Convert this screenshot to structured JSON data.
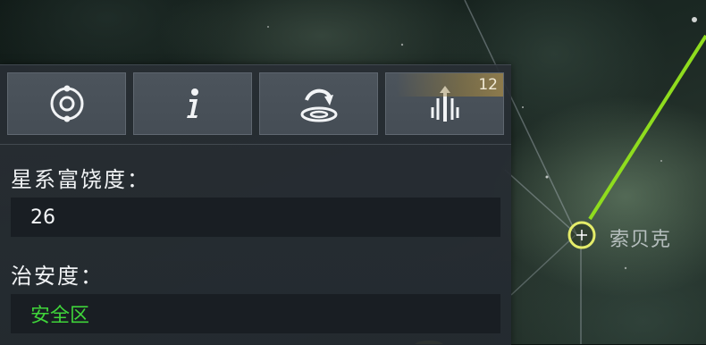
{
  "map": {
    "system_name": "索贝克",
    "lane_color": "#8fdc1e",
    "node_color": "#e4ec6a"
  },
  "panel": {
    "toolbar": [
      {
        "icon": "orbit-icon",
        "label": ""
      },
      {
        "icon": "info-icon",
        "label": ""
      },
      {
        "icon": "warp-target-icon",
        "label": ""
      },
      {
        "icon": "signal-upgrade-icon",
        "badge": "12"
      }
    ],
    "prosperity": {
      "label": "星系富饶度：",
      "value": "26"
    },
    "security": {
      "label": "治安度：",
      "value": "安全区",
      "value_color": "#3fd43a"
    }
  }
}
